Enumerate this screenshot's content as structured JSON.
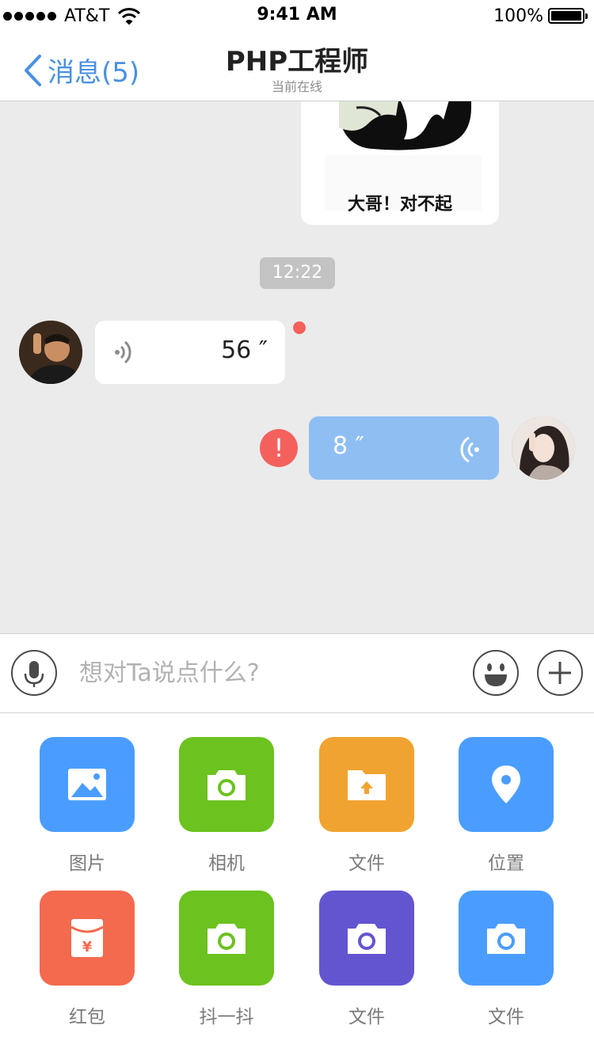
{
  "status_bar": {
    "carrier": "AT&T",
    "time": "9:41 AM",
    "battery": "100%"
  },
  "nav": {
    "back_label": "消息(5)",
    "title": "PHP工程师",
    "subtitle": "当前在线"
  },
  "chat": {
    "sticker_text": "大哥！对不起",
    "timestamp": "12:22",
    "incoming_voice_duration": "56 ″",
    "outgoing_voice_duration": "8 ″",
    "error_mark": "!"
  },
  "input": {
    "placeholder": "想对Ta说点什么?"
  },
  "tools": [
    {
      "label": "图片",
      "color": "#4a9dff",
      "icon": "image-icon"
    },
    {
      "label": "相机",
      "color": "#6cc21f",
      "icon": "camera-icon"
    },
    {
      "label": "文件",
      "color": "#f0a330",
      "icon": "folder-upload-icon"
    },
    {
      "label": "位置",
      "color": "#4a9dff",
      "icon": "location-pin-icon"
    },
    {
      "label": "红包",
      "color": "#f36a4f",
      "icon": "red-envelope-icon"
    },
    {
      "label": "抖一抖",
      "color": "#6cc21f",
      "icon": "camera-icon"
    },
    {
      "label": "文件",
      "color": "#6355d0",
      "icon": "camera-icon"
    },
    {
      "label": "文件",
      "color": "#4a9dff",
      "icon": "camera-icon"
    }
  ]
}
